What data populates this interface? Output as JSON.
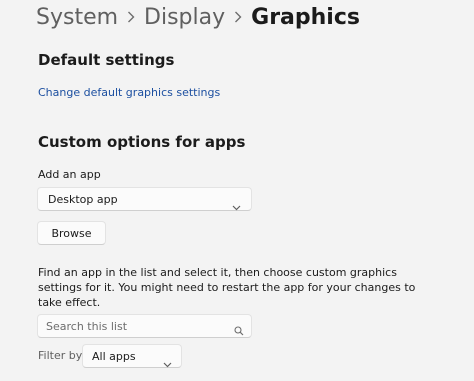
{
  "breadcrumb": {
    "items": [
      "System",
      "Display"
    ],
    "current": "Graphics"
  },
  "default_settings": {
    "heading": "Default settings",
    "link": "Change default graphics settings"
  },
  "custom_options": {
    "heading": "Custom options for apps",
    "add_app_label": "Add an app",
    "app_type_selected": "Desktop app",
    "browse_label": "Browse",
    "description_lines": [
      "Find an app in the list and select it, then choose custom graphics",
      "settings for it. You might need to restart the app for your changes to",
      "take effect."
    ],
    "search_placeholder": "Search this list",
    "filter_label": "Filter by:",
    "filter_selected": "All apps"
  },
  "icons": {
    "separator": "chevron-right-icon",
    "dropdown": "chevron-down-icon",
    "search": "search-icon"
  }
}
